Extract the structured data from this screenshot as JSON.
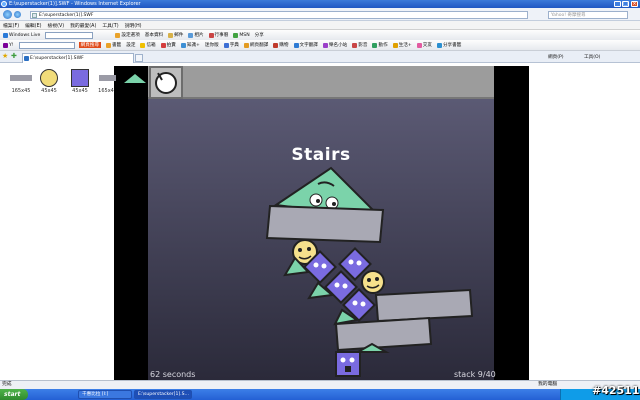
{
  "window": {
    "title": "E:\\superstacker(1)].SWF - Windows Internet Explorer",
    "address": "E:\\superstacker(1)].SWF",
    "search_placeholder": "Yahoo! 奇摩搜尋",
    "tab_label": "E:\\superstacker[1].SWF"
  },
  "menu": [
    "檔案(F)",
    "編輯(E)",
    "檢視(V)",
    "我的最愛(A)",
    "工具(T)",
    "說明(H)"
  ],
  "toolbar1": {
    "brand": "Windows Live",
    "items": [
      "設定選項",
      "基本資料",
      "郵件",
      "相片",
      "行事曆",
      "MSN",
      "分享"
    ]
  },
  "toolbar2": {
    "brand": "Y!",
    "items": [
      "網頁搜尋",
      "書籤",
      "設定",
      "信箱",
      "拍賣",
      "知識+",
      "迷你版",
      "字典",
      "網頁翻譯",
      "購物",
      "文字翻譯",
      "樂名小站",
      "影音",
      "動作",
      "生活+",
      "交友",
      "分享書籤"
    ]
  },
  "commandbar": [
    "網頁(P)",
    "工具(O)"
  ],
  "library": {
    "thumbs": [
      {
        "label": "165x45"
      },
      {
        "label": "45x45"
      },
      {
        "label": "45x45"
      },
      {
        "label": "165x4"
      }
    ]
  },
  "game": {
    "level_title": "Stairs",
    "timer": "62 seconds",
    "stack": "stack 9/40"
  },
  "statusbar": {
    "left": "完成",
    "zone": "我的電腦"
  },
  "taskbar": {
    "start": "start",
    "tasks": [
      "千惠比拉 [I:]",
      "E:\\superstacker[1].S..."
    ],
    "clock": "#42511"
  },
  "colors": {
    "green_shape": "#7bd3aa",
    "yellow_shape": "#f6e18c",
    "purple_shape": "#7a6be0",
    "gray_block": "#a9a9b4"
  }
}
